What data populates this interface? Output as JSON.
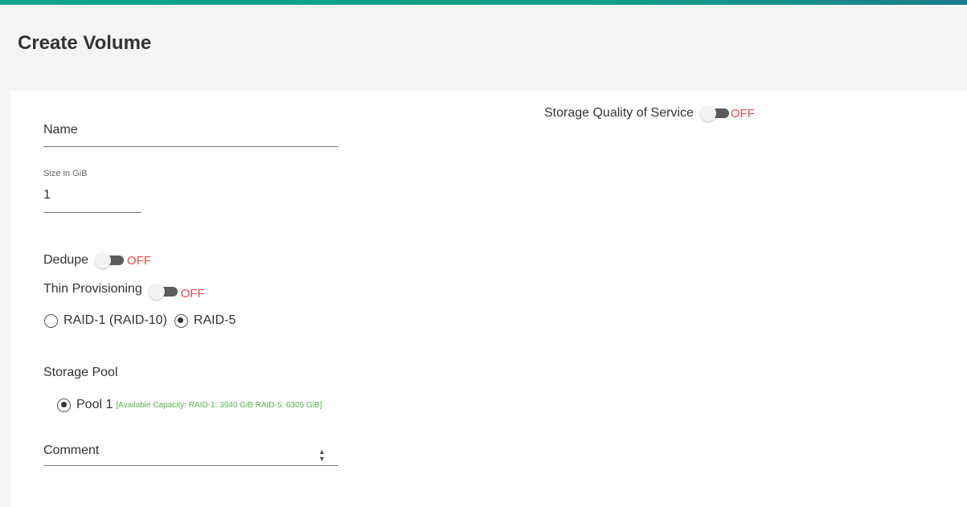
{
  "page": {
    "title": "Create Volume"
  },
  "form": {
    "name": {
      "placeholder": "Name",
      "value": ""
    },
    "size": {
      "label": "Size in GiB",
      "value": "1"
    },
    "dedupe": {
      "label": "Dedupe",
      "state": "OFF"
    },
    "thin_provisioning": {
      "label": "Thin Provisioning",
      "state": "OFF"
    },
    "raid": {
      "options": [
        {
          "label": "RAID-1 (RAID-10)",
          "checked": false
        },
        {
          "label": "RAID-5",
          "checked": true
        }
      ]
    },
    "storage_pool": {
      "label": "Storage Pool",
      "pools": [
        {
          "label": "Pool 1",
          "capacity": "[Available Capacity: RAID-1: 3940 GiB RAID-5: 6305 GiB]",
          "checked": true
        }
      ]
    },
    "comment": {
      "placeholder": "Comment",
      "value": ""
    },
    "qos": {
      "label": "Storage Quality of Service",
      "state": "OFF"
    }
  },
  "colors": {
    "accent": "#12a38c",
    "off": "#e44b4b",
    "capacity": "#59b34f"
  }
}
